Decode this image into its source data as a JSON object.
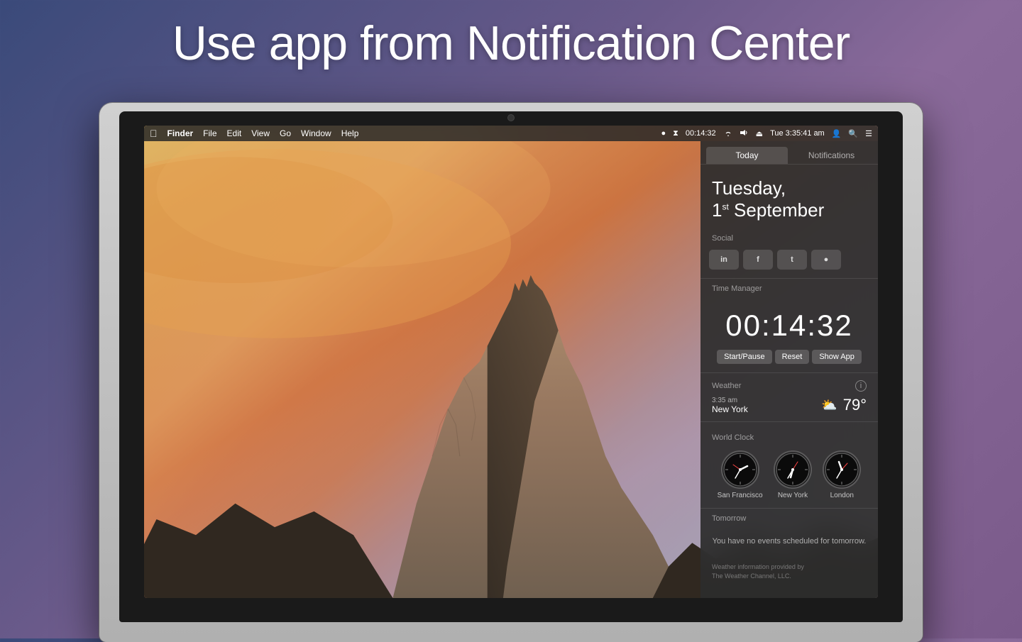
{
  "page": {
    "title": "Use app from Notification Center",
    "background": {
      "gradient_start": "#3a4a7a",
      "gradient_end": "#8a6a9a"
    }
  },
  "menubar": {
    "apple_symbol": "&#63743;",
    "finder_label": "Finder",
    "menu_items": [
      "File",
      "Edit",
      "View",
      "Go",
      "Window",
      "Help"
    ],
    "right_items": {
      "dot": "●",
      "hourglass": "⏳",
      "time_tracker": "00:14:32",
      "wifi": "WiFi",
      "volume": "🔊",
      "eject": "⏏",
      "datetime": "Tue 3:35:41 am",
      "user_icon": "👤",
      "search_icon": "🔍",
      "list_icon": "☰"
    }
  },
  "notification_center": {
    "tabs": {
      "today_label": "Today",
      "notifications_label": "Notifications",
      "active_tab": "today"
    },
    "date": {
      "day_name": "Tuesday,",
      "day_number": "1",
      "day_suffix": "st",
      "month": "September"
    },
    "social": {
      "section_label": "Social",
      "buttons": [
        {
          "id": "linkedin",
          "icon": "in"
        },
        {
          "id": "facebook",
          "icon": "f"
        },
        {
          "id": "twitter",
          "icon": "t"
        },
        {
          "id": "message",
          "icon": "●"
        }
      ]
    },
    "time_manager": {
      "section_label": "Time Manager",
      "display": "00:14:32",
      "buttons": {
        "start_pause": "Start/Pause",
        "reset": "Reset",
        "show_app": "Show App"
      }
    },
    "weather": {
      "section_label": "Weather",
      "time": "3:35 am",
      "location": "New York",
      "icon": "⛅",
      "temperature": "79°",
      "info_icon": "i"
    },
    "world_clock": {
      "section_label": "World Clock",
      "clocks": [
        {
          "city": "San Francisco",
          "hour_angle": -60,
          "minute_angle": 160,
          "second_angle": 210
        },
        {
          "city": "New York",
          "hour_angle": -30,
          "minute_angle": 160,
          "second_angle": 210
        },
        {
          "city": "London",
          "hour_angle": 40,
          "minute_angle": 160,
          "second_angle": 210
        }
      ]
    },
    "tomorrow": {
      "section_label": "Tomorrow",
      "message": "You have no events scheduled for tomorrow."
    },
    "attribution": {
      "line1": "Weather information provided by",
      "line2": "The Weather Channel, LLC."
    }
  }
}
